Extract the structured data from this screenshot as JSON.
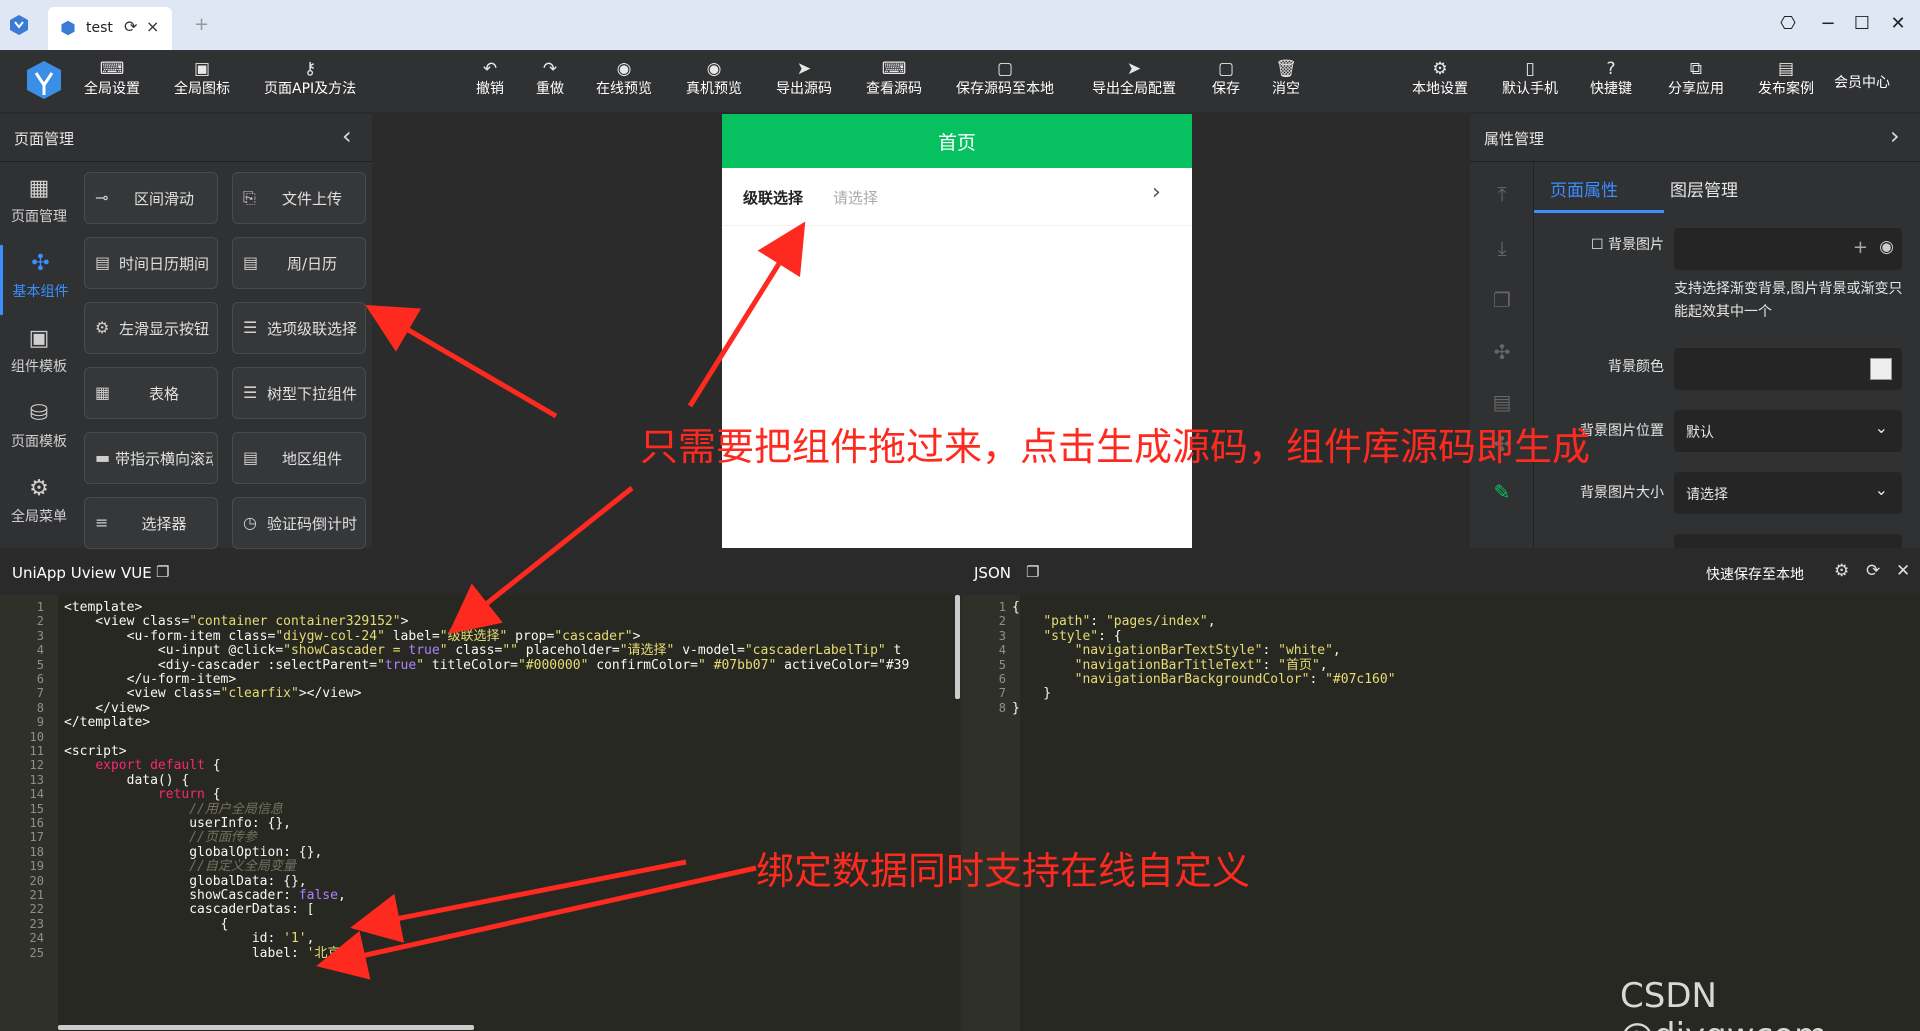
{
  "window": {
    "tab_title": "test",
    "reload_icon": "reload-icon",
    "close_label": "×",
    "add_label": "+",
    "controls": [
      "settings-icon",
      "minimize-icon",
      "maximize-icon",
      "close-icon"
    ]
  },
  "toolbar": {
    "left": [
      "全局设置",
      "全局图标",
      "页面API及方法"
    ],
    "center": [
      "撤销",
      "重做",
      "在线预览",
      "真机预览",
      "导出源码",
      "查看源码",
      "保存源码至本地",
      "导出全局配置",
      "保存",
      "消空"
    ],
    "right": [
      "本地设置",
      "默认手机",
      "快捷键",
      "分享应用",
      "发布案例"
    ],
    "member": "会员中心",
    "icons_left": [
      "code-icon",
      "image-icon",
      "plugin-icon"
    ],
    "icons_center": [
      "undo-icon",
      "redo-icon",
      "eye-icon",
      "eye-icon",
      "send-icon",
      "code-icon",
      "save-icon",
      "send-icon",
      "save-icon",
      "trash-icon"
    ],
    "icons_right": [
      "gear-icon",
      "phone-icon",
      "question-icon",
      "share-icon",
      "publish-icon"
    ]
  },
  "left_panel": {
    "title": "页面管理",
    "nav": [
      {
        "label": "页面管理",
        "icon": "grid-icon"
      },
      {
        "label": "基本组件",
        "icon": "puzzle-icon",
        "active": true
      },
      {
        "label": "组件模板",
        "icon": "template-icon"
      },
      {
        "label": "页面模板",
        "icon": "database-icon"
      },
      {
        "label": "全局菜单",
        "icon": "gear-icon"
      }
    ],
    "components": [
      {
        "label": "区间滑动",
        "icon": "slider-icon"
      },
      {
        "label": "文件上传",
        "icon": "file-icon"
      },
      {
        "label": "时间日历期间",
        "icon": "calendar-icon"
      },
      {
        "label": "周/日历",
        "icon": "calendar-icon"
      },
      {
        "label": "左滑显示按钮",
        "icon": "gear-icon"
      },
      {
        "label": "选项级联选择",
        "icon": "list-icon"
      },
      {
        "label": "表格",
        "icon": "table-icon"
      },
      {
        "label": "树型下拉组件",
        "icon": "list-icon"
      },
      {
        "label": "带指示横向滚动",
        "icon": "scroll-icon"
      },
      {
        "label": "地区组件",
        "icon": "calendar-icon"
      },
      {
        "label": "选择器",
        "icon": "menu-icon"
      },
      {
        "label": "验证码倒计时",
        "icon": "clock-icon"
      }
    ]
  },
  "phone": {
    "title": "首页",
    "field_label": "级联选择",
    "field_placeholder": "请选择"
  },
  "right_panel": {
    "title": "属性管理",
    "tabs": [
      "页面属性",
      "图层管理"
    ],
    "bg_image_label": "背景图片",
    "bg_hint": "支持选择渐变背景,图片背景或渐变只能起效其中一个",
    "bg_color_label": "背景颜色",
    "bg_pos_label": "背景图片位置",
    "bg_pos_value": "默认",
    "bg_size_label": "背景图片大小",
    "bg_size_value": "请选择",
    "side_icons": [
      "arrow-up-icon",
      "arrow-down-icon",
      "copy-icon",
      "puzzle-icon",
      "doc-icon",
      "puzzle-icon",
      "edit-icon"
    ]
  },
  "code_left": {
    "title": "UniApp Uview VUE",
    "line_numbers": [
      "1",
      "2",
      "3",
      "4",
      "5",
      "6",
      "7",
      "8",
      "9",
      "10",
      "11",
      "12",
      "13",
      "14",
      "15",
      "16",
      "17",
      "18",
      "19",
      "20",
      "21",
      "22",
      "23",
      "24",
      "25"
    ],
    "lines": [
      "<template>",
      "    <view class=\"container container329152\">",
      "        <u-form-item class=\"diygw-col-24\" label=\"级联选择\" prop=\"cascader\">",
      "            <u-input @click=\"showCascader = true\" class=\"\" placeholder=\"请选择\" v-model=\"cascaderLabelTip\" t",
      "            <diy-cascader :selectParent=\"true\" titleColor=\"#000000\" confirmColor=\" #07bb07\" activeColor=\"#39",
      "        </u-form-item>",
      "        <view class=\"clearfix\"></view>",
      "    </view>",
      "</template>",
      "",
      "<script>",
      "    export default {",
      "        data() {",
      "            return {",
      "                //用户全局信息",
      "                userInfo: {},",
      "                //页面传参",
      "                globalOption: {},",
      "                //自定义全局变量",
      "                globalData: {},",
      "                showCascader: false,",
      "                cascaderDatas: [",
      "                    {",
      "                        id: '1',",
      "                        label: '北京市',"
    ]
  },
  "code_right": {
    "title": "JSON",
    "quick_save": "快速保存至本地",
    "line_numbers": [
      "1",
      "2",
      "3",
      "4",
      "5",
      "6",
      "7",
      "8"
    ],
    "lines": [
      "{",
      "    \"path\": \"pages/index\",",
      "    \"style\": {",
      "        \"navigationBarTextStyle\": \"white\",",
      "        \"navigationBarTitleText\": \"首页\",",
      "        \"navigationBarBackgroundColor\": \"#07c160\"",
      "    }",
      "}"
    ]
  },
  "annotations": {
    "top": "只需要把组件拖过来，点击生成源码，组件库源码即生成",
    "bottom": "绑定数据同时支持在线自定义"
  },
  "watermark": "CSDN @diygwcom",
  "colors": {
    "accent": "#3b8eff",
    "nav_green": "#07c160",
    "annotation": "#ff2a1f"
  }
}
